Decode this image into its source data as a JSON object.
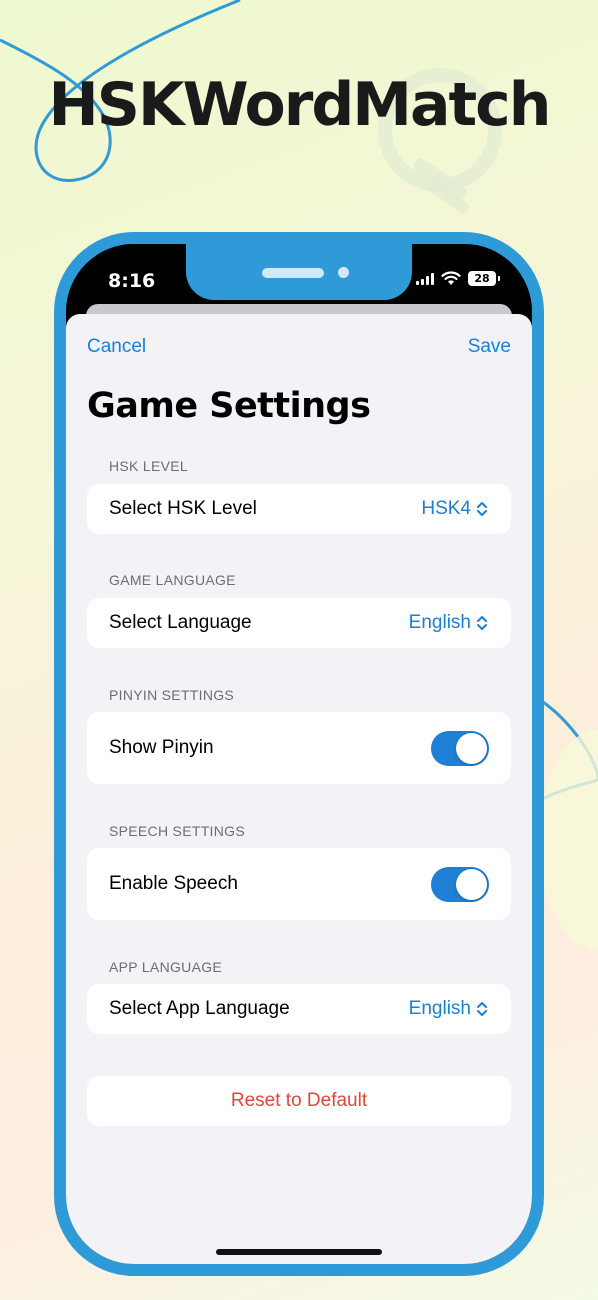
{
  "promo": {
    "headline": "HSKWordMatch"
  },
  "status_bar": {
    "time": "8:16",
    "battery": "28"
  },
  "nav": {
    "cancel_label": "Cancel",
    "save_label": "Save"
  },
  "page": {
    "title": "Game Settings"
  },
  "sections": [
    {
      "header": "HSK LEVEL",
      "label": "Select HSK Level",
      "value": "HSK4",
      "control": "picker"
    },
    {
      "header": "GAME LANGUAGE",
      "label": "Select Language",
      "value": "English",
      "control": "picker"
    },
    {
      "header": "PINYIN SETTINGS",
      "label": "Show Pinyin",
      "on": true,
      "control": "toggle"
    },
    {
      "header": "SPEECH SETTINGS",
      "label": "Enable Speech",
      "on": true,
      "control": "toggle"
    },
    {
      "header": "APP LANGUAGE",
      "label": "Select App Language",
      "value": "English",
      "control": "picker"
    }
  ],
  "reset_label": "Reset to Default",
  "colors": {
    "accent": "#1a7fd6",
    "destructive": "#e5453b",
    "frame": "#2f9ad8",
    "toggle_on": "#1f7fd4"
  },
  "icons": [
    "wifi-icon",
    "cellular-signal-icon",
    "battery-icon",
    "chevron-up-down-icon",
    "lightbulb-icon"
  ]
}
